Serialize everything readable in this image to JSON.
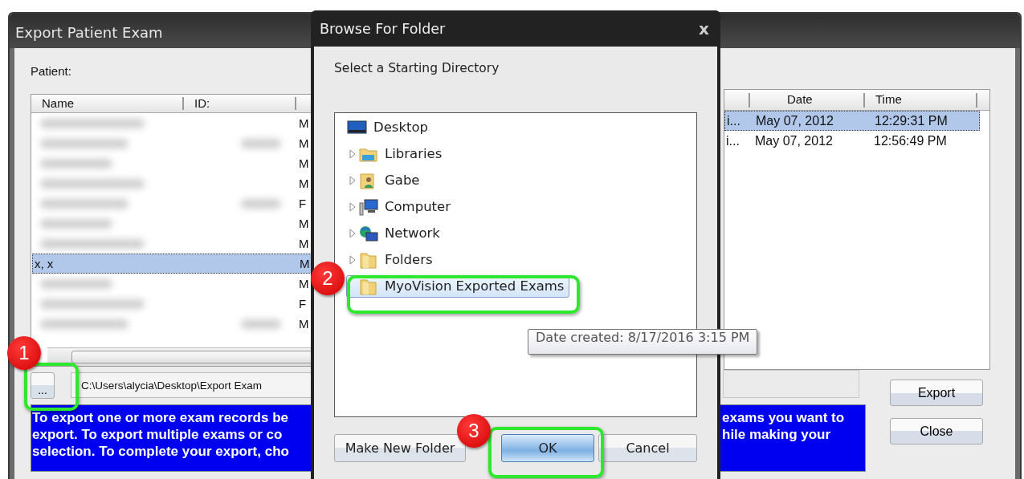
{
  "main_window": {
    "title": "Export Patient Exam",
    "patient_label": "Patient:",
    "patient_list": {
      "columns": [
        "Name",
        "ID:"
      ],
      "rows": [
        {
          "redacted": true,
          "gender": "M",
          "selected": false
        },
        {
          "redacted": true,
          "gender": "M",
          "selected": false
        },
        {
          "redacted": true,
          "gender": "M",
          "selected": false
        },
        {
          "redacted": true,
          "gender": "M",
          "selected": false
        },
        {
          "redacted": true,
          "gender": "F",
          "selected": false
        },
        {
          "redacted": true,
          "gender": "M",
          "selected": false
        },
        {
          "redacted": true,
          "gender": "M",
          "selected": false
        },
        {
          "redacted": false,
          "name": "x, x",
          "gender": "M",
          "selected": true
        },
        {
          "redacted": true,
          "gender": "M",
          "selected": false
        },
        {
          "redacted": true,
          "gender": "F",
          "selected": false
        },
        {
          "redacted": true,
          "gender": "M",
          "selected": false
        }
      ]
    },
    "exam_list": {
      "columns": [
        "Date",
        "Time"
      ],
      "rows": [
        {
          "column_1": "i...",
          "date": "May 07, 2012",
          "time": "12:29:31 PM",
          "selected": true
        },
        {
          "column_1": "i...",
          "date": "May 07, 2012",
          "time": "12:56:49 PM",
          "selected": false
        }
      ]
    },
    "browse_button": "...",
    "path": "C:\\Users\\alycia\\Desktop\\Export Exam",
    "instructions_left": "To export one or more exam records be\nexport. To export multiple exams or co\nselection. To complete your export, cho",
    "instructions_right": "exams you want to\nhile making your",
    "buttons": [
      "Export",
      "Close"
    ]
  },
  "dialog": {
    "title": "Browse For Folder",
    "close": "x",
    "prompt": "Select a Starting Directory",
    "tree": [
      {
        "label": "Desktop",
        "kind": "desktop",
        "selected": false,
        "children": [
          {
            "label": "Libraries",
            "kind": "library",
            "expandable": true,
            "selected": false
          },
          {
            "label": "Gabe",
            "kind": "user",
            "expandable": true,
            "selected": false
          },
          {
            "label": "Computer",
            "kind": "computer",
            "expandable": true,
            "selected": false
          },
          {
            "label": "Network",
            "kind": "network",
            "expandable": true,
            "selected": false
          },
          {
            "label": "Folders",
            "kind": "folder",
            "expandable": true,
            "selected": false
          },
          {
            "label": "MyoVision Exported Exams",
            "kind": "folder",
            "expandable": false,
            "selected": true
          }
        ]
      }
    ],
    "tooltip": "Date created: 8/17/2016 3:15 PM",
    "buttons": [
      {
        "label": "Make New Folder",
        "default": false
      },
      {
        "label": "OK",
        "default": true
      },
      {
        "label": "Cancel",
        "default": false
      }
    ]
  },
  "annotations": [
    {
      "number": "1"
    },
    {
      "number": "2"
    },
    {
      "number": "3"
    }
  ]
}
